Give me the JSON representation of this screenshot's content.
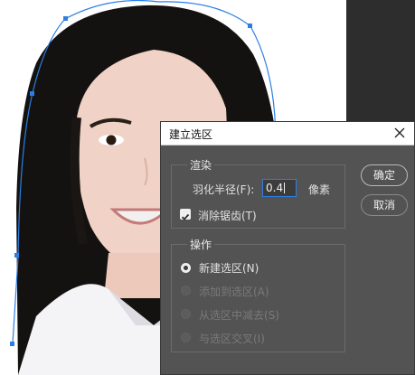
{
  "dialog": {
    "title": "建立选区",
    "rendering": {
      "legend": "渲染",
      "feather_label": "羽化半径(F):",
      "feather_value": "0.4",
      "feather_unit": "像素",
      "antialias_label": "消除锯齿(T)",
      "antialias_checked": true
    },
    "operation": {
      "legend": "操作",
      "options": [
        {
          "label": "新建选区(N)",
          "selected": true,
          "enabled": true
        },
        {
          "label": "添加到选区(A)",
          "selected": false,
          "enabled": false
        },
        {
          "label": "从选区中减去(S)",
          "selected": false,
          "enabled": false
        },
        {
          "label": "与选区交叉(I)",
          "selected": false,
          "enabled": false
        }
      ]
    },
    "buttons": {
      "ok": "确定",
      "cancel": "取消"
    }
  },
  "colors": {
    "dialog_bg": "#535353",
    "path_stroke": "#2a7ee6",
    "panel_bg": "#2d2d2d"
  }
}
